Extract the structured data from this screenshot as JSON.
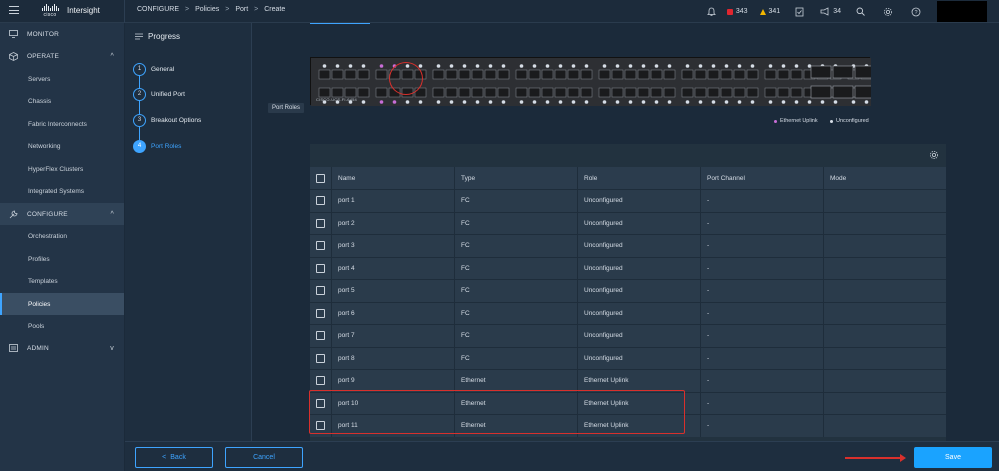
{
  "header": {
    "brand": "Intersight",
    "logo_text": "cisco",
    "breadcrumbs": [
      "CONFIGURE",
      "Policies",
      "Port",
      "Create"
    ],
    "alerts": {
      "critical": "343",
      "warning": "341",
      "announcements": "34"
    }
  },
  "sidebar": {
    "sections": [
      {
        "label": "MONITOR",
        "icon": "monitor-icon"
      },
      {
        "label": "OPERATE",
        "icon": "cube-icon"
      },
      {
        "label": "CONFIGURE",
        "icon": "wrench-icon"
      },
      {
        "label": "ADMIN",
        "icon": "admin-icon"
      }
    ],
    "operate_items": [
      "Servers",
      "Chassis",
      "Fabric Interconnects",
      "Networking",
      "HyperFlex Clusters",
      "Integrated Systems"
    ],
    "configure_items": [
      "Orchestration",
      "Profiles",
      "Templates",
      "Policies",
      "Pools"
    ],
    "active_item": "Policies"
  },
  "progress": {
    "title": "Progress",
    "steps": [
      {
        "num": "1",
        "label": "General"
      },
      {
        "num": "2",
        "label": "Unified Port"
      },
      {
        "num": "3",
        "label": "Breakout Options"
      },
      {
        "num": "4",
        "label": "Port Roles"
      }
    ],
    "current_step": 4
  },
  "switch": {
    "model": "CISCO-UCS-FI-6454",
    "tooltip": "Port Roles"
  },
  "legend": [
    {
      "label": "Ethernet Uplink",
      "color": "#c86dd7"
    },
    {
      "label": "Unconfigured",
      "color": "#d6dde6"
    }
  ],
  "table": {
    "columns": [
      "Name",
      "Type",
      "Role",
      "Port Channel",
      "Mode"
    ],
    "rows": [
      {
        "name": "port 1",
        "type": "FC",
        "role": "Unconfigured",
        "pc": "-"
      },
      {
        "name": "port 2",
        "type": "FC",
        "role": "Unconfigured",
        "pc": "-"
      },
      {
        "name": "port 3",
        "type": "FC",
        "role": "Unconfigured",
        "pc": "-"
      },
      {
        "name": "port 4",
        "type": "FC",
        "role": "Unconfigured",
        "pc": "-"
      },
      {
        "name": "port 5",
        "type": "FC",
        "role": "Unconfigured",
        "pc": "-"
      },
      {
        "name": "port 6",
        "type": "FC",
        "role": "Unconfigured",
        "pc": "-"
      },
      {
        "name": "port 7",
        "type": "FC",
        "role": "Unconfigured",
        "pc": "-"
      },
      {
        "name": "port 8",
        "type": "FC",
        "role": "Unconfigured",
        "pc": "-"
      },
      {
        "name": "port 9",
        "type": "Ethernet",
        "role": "Ethernet Uplink",
        "pc": "-"
      },
      {
        "name": "port 10",
        "type": "Ethernet",
        "role": "Ethernet Uplink",
        "pc": "-"
      },
      {
        "name": "port 11",
        "type": "Ethernet",
        "role": "Ethernet Uplink",
        "pc": "-"
      }
    ]
  },
  "footer": {
    "back_label": "Back",
    "cancel_label": "Cancel",
    "save_label": "Save"
  },
  "colors": {
    "accent": "#3ea4ff",
    "highlight": "#d9302c",
    "save": "#1aa3ff"
  }
}
